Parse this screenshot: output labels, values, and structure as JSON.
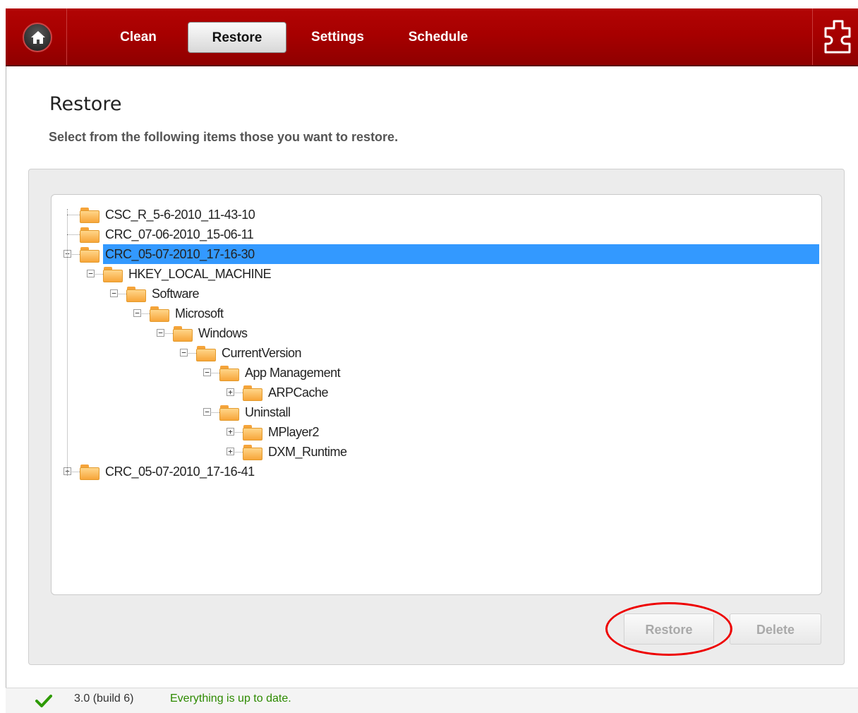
{
  "nav": {
    "items": [
      "Clean",
      "Restore",
      "Settings",
      "Schedule"
    ],
    "active": "Restore"
  },
  "page": {
    "title": "Restore",
    "subtitle": "Select from the following items those you want to restore."
  },
  "tree": [
    {
      "label": "CSC_R_5-6-2010_11-43-10",
      "depth": 0,
      "toggle": "",
      "selected": false
    },
    {
      "label": "CRC_07-06-2010_15-06-11",
      "depth": 0,
      "toggle": "",
      "selected": false
    },
    {
      "label": "CRC_05-07-2010_17-16-30",
      "depth": 0,
      "toggle": "minus",
      "selected": true
    },
    {
      "label": "HKEY_LOCAL_MACHINE",
      "depth": 1,
      "toggle": "minus",
      "selected": false
    },
    {
      "label": "Software",
      "depth": 2,
      "toggle": "minus",
      "selected": false
    },
    {
      "label": "Microsoft",
      "depth": 3,
      "toggle": "minus",
      "selected": false
    },
    {
      "label": "Windows",
      "depth": 4,
      "toggle": "minus",
      "selected": false
    },
    {
      "label": "CurrentVersion",
      "depth": 5,
      "toggle": "minus",
      "selected": false
    },
    {
      "label": "App Management",
      "depth": 6,
      "toggle": "minus",
      "selected": false
    },
    {
      "label": "ARPCache",
      "depth": 7,
      "toggle": "plus",
      "selected": false
    },
    {
      "label": "Uninstall",
      "depth": 6,
      "toggle": "minus",
      "selected": false
    },
    {
      "label": "MPlayer2",
      "depth": 7,
      "toggle": "plus",
      "selected": false
    },
    {
      "label": "DXM_Runtime",
      "depth": 7,
      "toggle": "plus",
      "selected": false
    },
    {
      "label": "CRC_05-07-2010_17-16-41",
      "depth": 0,
      "toggle": "plus",
      "selected": false
    }
  ],
  "buttons": {
    "restore": "Restore",
    "delete": "Delete"
  },
  "status": {
    "version": "3.0 (build 6)",
    "message": "Everything is up to date."
  },
  "icons": {
    "home": "home-icon",
    "puzzle": "puzzle-icon",
    "check": "check-icon",
    "folder": "folder-icon"
  },
  "colors": {
    "topbar": "#a70000",
    "selection": "#3399ff",
    "status_ok": "#2d8a00",
    "highlight_ring": "#ee0000"
  }
}
